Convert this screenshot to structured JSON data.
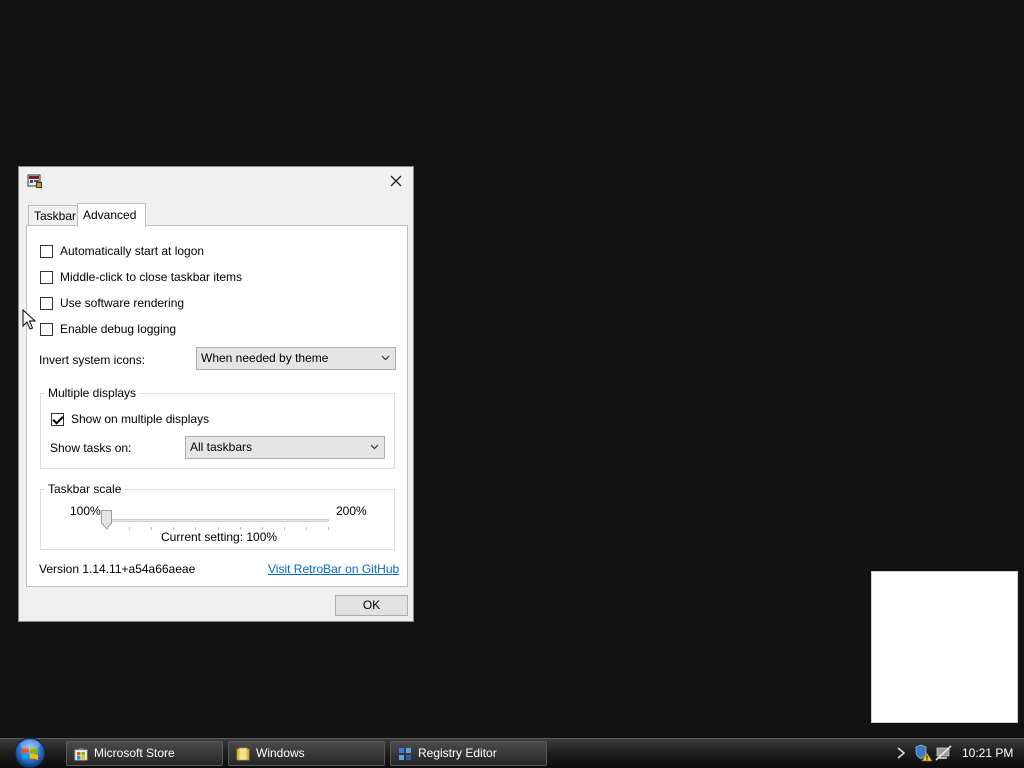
{
  "dialog": {
    "tabs": [
      {
        "label": "Taskbar"
      },
      {
        "label": "Advanced"
      }
    ],
    "options": {
      "auto_start": {
        "label": "Automatically start at logon",
        "checked": false
      },
      "middle_click": {
        "label": "Middle-click to close taskbar items",
        "checked": false
      },
      "software_rendering": {
        "label": "Use software rendering",
        "checked": false
      },
      "debug_logging": {
        "label": "Enable debug logging",
        "checked": false
      }
    },
    "invert_icons": {
      "label": "Invert system icons:",
      "value": "When needed by theme"
    },
    "multiple_displays": {
      "title": "Multiple displays",
      "show_on_multiple": {
        "label": "Show on multiple displays",
        "checked": true
      },
      "show_tasks_on": {
        "label": "Show tasks on:",
        "value": "All taskbars"
      }
    },
    "taskbar_scale": {
      "title": "Taskbar scale",
      "min_label": "100%",
      "max_label": "200%",
      "current": "Current setting: 100%",
      "value_fraction": 0
    },
    "version": "Version 1.14.11+a54a66aeae",
    "github_link": "Visit RetroBar on GitHub",
    "ok_label": "OK"
  },
  "taskbar": {
    "buttons": [
      {
        "label": "Microsoft Store",
        "icon": "store-icon"
      },
      {
        "label": "Windows",
        "icon": "folder-icon"
      },
      {
        "label": "Registry Editor",
        "icon": "registry-icon"
      }
    ],
    "clock": "10:21 PM"
  },
  "colors": {
    "desktop": "#121212",
    "link": "#0066cc",
    "taskbar_text": "#ffffff"
  }
}
